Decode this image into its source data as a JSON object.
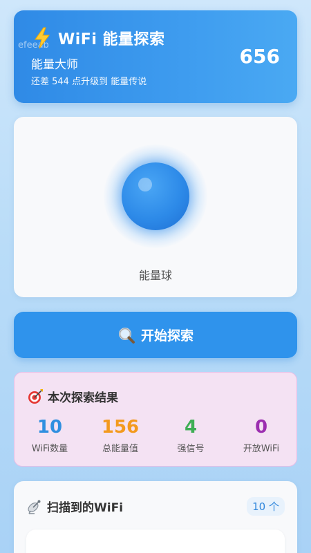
{
  "header": {
    "watermark": "efeeab",
    "title": "WiFi 能量探索",
    "level_name": "能量大师",
    "level_hint": "还差 544 点升级到 能量传说",
    "score": "656",
    "icon": "lightning-bolt-icon"
  },
  "orb": {
    "label": "能量球"
  },
  "start_button": {
    "label": "开始探索",
    "icon": "magnifier-icon"
  },
  "results": {
    "title": "本次探索结果",
    "icon": "target-icon",
    "stats": [
      {
        "value": "10",
        "label": "WiFi数量",
        "color": "#2f8fe0"
      },
      {
        "value": "156",
        "label": "总能量值",
        "color": "#f39a1e"
      },
      {
        "value": "4",
        "label": "强信号",
        "color": "#3fae55"
      },
      {
        "value": "0",
        "label": "开放WiFi",
        "color": "#9c2fb0"
      }
    ]
  },
  "wifi_list": {
    "title": "扫描到的WiFi",
    "icon": "satellite-icon",
    "count": "10 个"
  },
  "colors": {
    "primary": "#2f93ec",
    "header_gradient_start": "#2f8ae6",
    "results_bg": "#f4e2f3"
  }
}
